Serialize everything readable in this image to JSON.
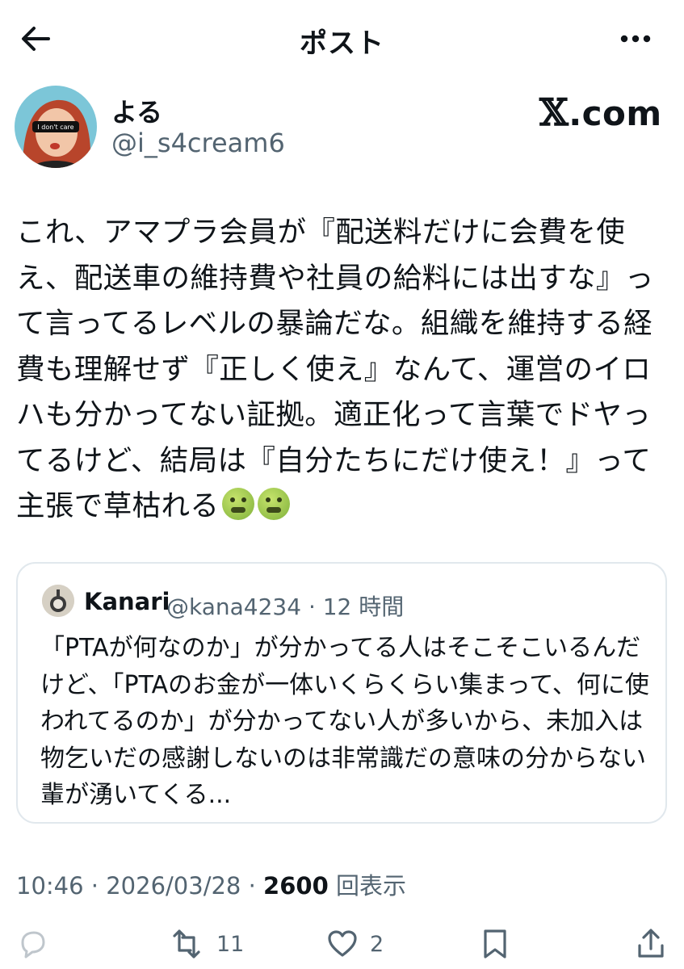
{
  "header": {
    "title": "ポスト"
  },
  "author": {
    "display_name": "よる",
    "handle": "@i_s4cream6",
    "avatar_text": "I don't care"
  },
  "brand": {
    "mark": "𝕏",
    "text": ".com"
  },
  "tweet": {
    "text": "これ、アマプラ会員が『配送料だけに会費を使え、配送車の維持費や社員の給料には出すな』って言ってるレベルの暴論だな。組織を維持する経費も理解せず『正しく使え』なんて、運営のイロハも分かってない証拠。適正化って言葉でドヤってるけど、結局は『自分たちにだけ使え！』って主張で草枯れる"
  },
  "quote": {
    "name": "Kanari",
    "meta": "@kana4234 · 12 時間",
    "text": "「PTAが何なのか」が分かってる人はそこそこいるんだけど、「PTAのお金が一体いくらくらい集まって、何に使われてるのか」が分かってない人が多いから、未加入は物乞いだの感謝しないのは非常識だの意味の分からない輩が湧いてくる..."
  },
  "meta": {
    "time": "10:46 · 2026/03/28 · ",
    "views": "2600",
    "views_label": " 回表示"
  },
  "actions": {
    "retweets": "11",
    "likes": "2"
  },
  "colors": {
    "text": "#0f1419",
    "muted": "#536471",
    "border": "#e1e8ed"
  }
}
